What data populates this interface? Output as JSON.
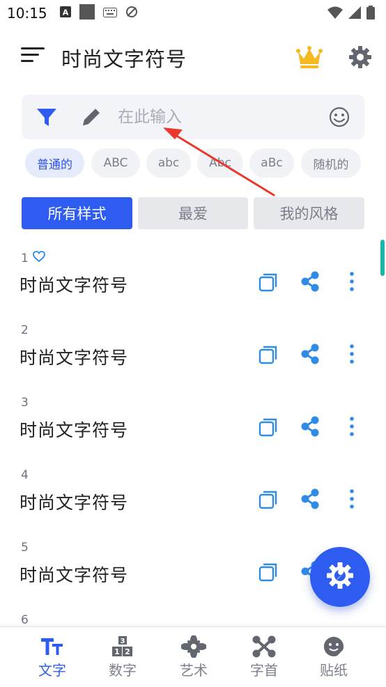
{
  "status_bar": {
    "time": "10:15",
    "icons": [
      "a-badge-icon",
      "square-icon",
      "keyboard-icon",
      "no-sync-icon",
      "wifi-icon",
      "signal-icon",
      "battery-icon"
    ]
  },
  "app_bar": {
    "title": "时尚文字符号",
    "icons": {
      "menu": "menu-icon",
      "crown": "crown-icon",
      "settings": "gear-icon"
    }
  },
  "search": {
    "placeholder": "在此输入",
    "value": "",
    "icons": {
      "filter": "filter-icon",
      "pencil": "pencil-icon",
      "emoji": "smiley-icon"
    }
  },
  "chips": [
    {
      "label": "普通的",
      "active": true
    },
    {
      "label": "ABC",
      "active": false
    },
    {
      "label": "abc",
      "active": false
    },
    {
      "label": "Abc",
      "active": false
    },
    {
      "label": "aBc",
      "active": false
    },
    {
      "label": "随机的",
      "active": false
    }
  ],
  "tabs": [
    {
      "label": "所有样式",
      "active": true
    },
    {
      "label": "最爱",
      "active": false
    },
    {
      "label": "我的风格",
      "active": false
    }
  ],
  "items": [
    {
      "number": "1",
      "text": "时尚文字符号",
      "favorite_icon": true
    },
    {
      "number": "2",
      "text": "时尚文字符号"
    },
    {
      "number": "3",
      "text": "时尚文字符号"
    },
    {
      "number": "4",
      "text": "时尚文字符号"
    },
    {
      "number": "5",
      "text": "时尚文字符号"
    },
    {
      "number": "6",
      "text": ""
    }
  ],
  "fab": {
    "icon": "gear-wrench-icon"
  },
  "bottom_nav": [
    {
      "label": "文字",
      "icon": "text-size-icon",
      "active": true
    },
    {
      "label": "数字",
      "icon": "number-blocks-icon",
      "active": false
    },
    {
      "label": "艺术",
      "icon": "flower-icon",
      "active": false
    },
    {
      "label": "字首",
      "icon": "molecule-icon",
      "active": false
    },
    {
      "label": "贴纸",
      "icon": "sticker-face-icon",
      "active": false
    }
  ],
  "colors": {
    "accent": "#2f5cf0",
    "icon_blue": "#2f8be6",
    "crown": "#f5b921",
    "annotation": "#e8392c",
    "scroll": "#1db5a7"
  }
}
